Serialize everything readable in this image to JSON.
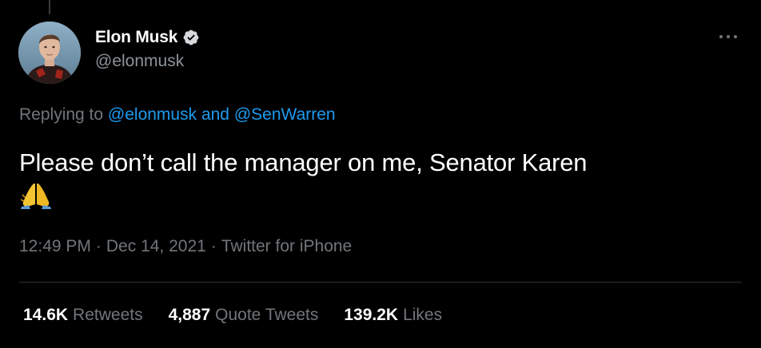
{
  "author": {
    "display_name": "Elon Musk",
    "handle": "@elonmusk",
    "verified": true
  },
  "reply": {
    "prefix": "Replying to",
    "mention_1": "@elonmusk",
    "conjunction": "and",
    "mention_2": "@SenWarren"
  },
  "tweet": {
    "text": "Please don’t call the manager on me, Senator Karen",
    "emoji": "folded-hands"
  },
  "meta": {
    "time": "12:49 PM",
    "date": "Dec 14, 2021",
    "source": "Twitter for iPhone",
    "separator": "·"
  },
  "stats": {
    "retweets_count": "14.6K",
    "retweets_label": "Retweets",
    "quotes_count": "4,887",
    "quotes_label": "Quote Tweets",
    "likes_count": "139.2K",
    "likes_label": "Likes"
  },
  "colors": {
    "background": "#000000",
    "link": "#1d9bf0",
    "secondary_text": "#71767b",
    "primary_text": "#ffffff"
  },
  "icons": {
    "verified": "verified-badge-icon",
    "more": "more-options-icon"
  }
}
